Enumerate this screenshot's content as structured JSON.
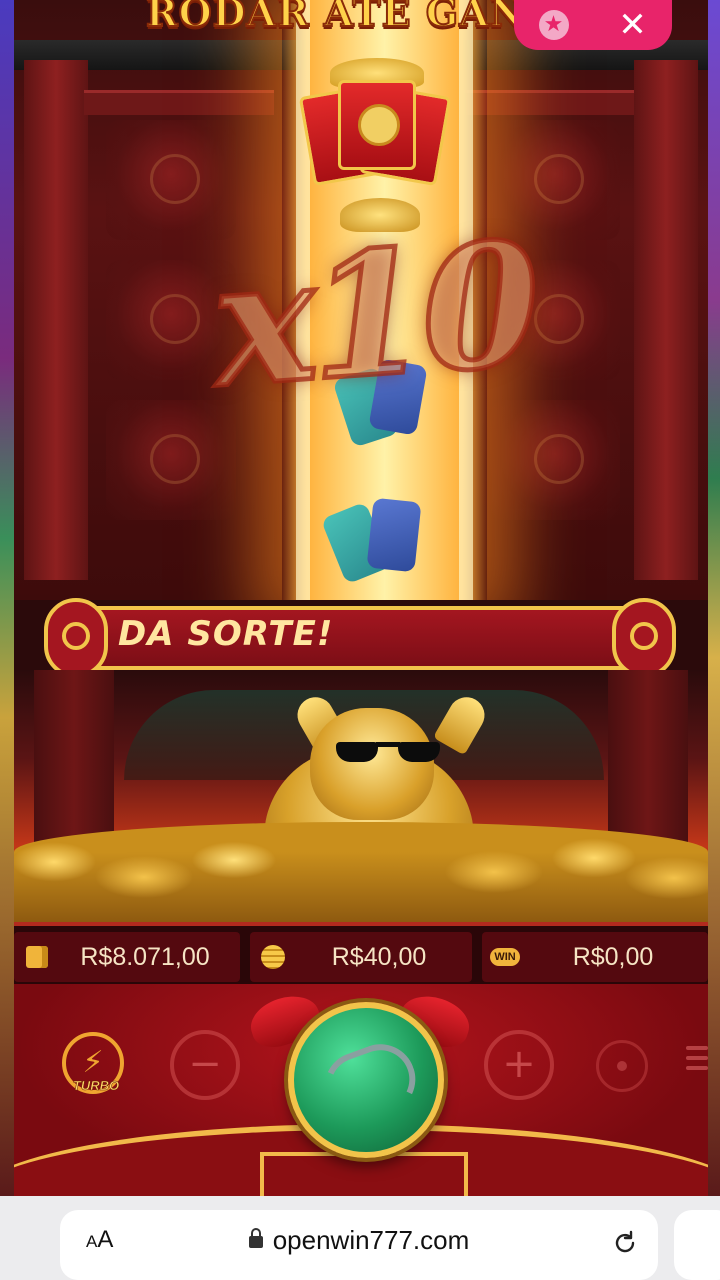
{
  "game": {
    "title_banner": "RODAR ATÉ GANH",
    "multiplier": "x10",
    "lucky_banner": "DA SORTE!",
    "balance": "R$8.071,00",
    "bet": "R$40,00",
    "win": "R$0,00",
    "win_badge": "WIN",
    "turbo_label": "TURBO",
    "minus_symbol": "−",
    "plus_symbol": "+"
  },
  "top_controls": {
    "favorite_icon": "star-icon",
    "close_icon": "close-icon",
    "close_symbol": "✕",
    "star_symbol": "★"
  },
  "browser": {
    "text_size_label_small": "A",
    "text_size_label_large": "A",
    "url": "openwin777.com",
    "lock_icon": "lock-icon",
    "reload_icon": "reload-icon"
  },
  "colors": {
    "accent_pink": "#e8246a",
    "gold": "#f1c54b",
    "deep_red": "#7c0e16",
    "spin_green": "#1d9a5a"
  }
}
